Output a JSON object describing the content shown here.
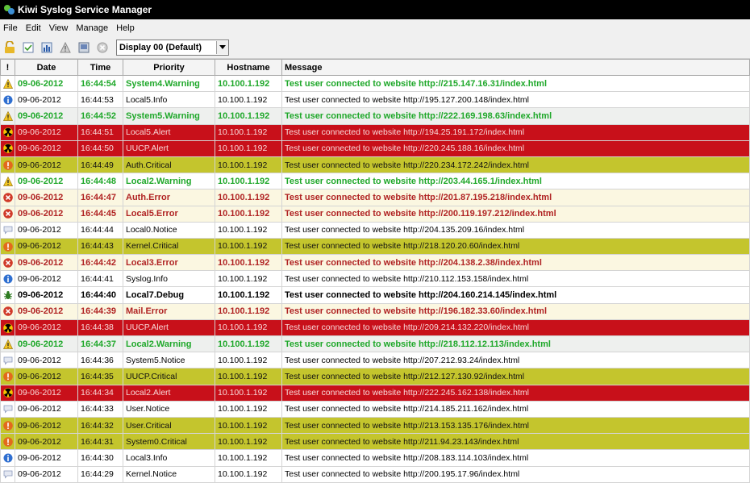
{
  "window": {
    "title": "Kiwi Syslog Service Manager"
  },
  "menu": [
    "File",
    "Edit",
    "View",
    "Manage",
    "Help"
  ],
  "toolbar": {
    "display_select": "Display 00 (Default)",
    "icons": [
      "unlock-icon",
      "checklist-icon",
      "stats-icon",
      "warning-icon",
      "clear-icon",
      "stop-icon"
    ]
  },
  "table": {
    "headers": [
      "!",
      "Date",
      "Time",
      "Priority",
      "Hostname",
      "Message"
    ],
    "rows": [
      {
        "icon": "warning",
        "style": "g bold",
        "date": "09-06-2012",
        "time": "16:44:54",
        "priority": "System4.Warning",
        "host": "10.100.1.192",
        "msg": "Test user connected to website http://215.147.16.31/index.html"
      },
      {
        "icon": "info",
        "style": "",
        "date": "09-06-2012",
        "time": "16:44:53",
        "priority": "Local5.Info",
        "host": "10.100.1.192",
        "msg": "Test user connected to website http://195.127.200.148/index.html"
      },
      {
        "icon": "warning",
        "style": "g bold alt",
        "date": "09-06-2012",
        "time": "16:44:52",
        "priority": "System5.Warning",
        "host": "10.100.1.192",
        "msg": "Test user connected to website http://222.169.198.63/index.html"
      },
      {
        "icon": "alert",
        "style": "sel",
        "date": "09-06-2012",
        "time": "16:44:51",
        "priority": "Local5.Alert",
        "host": "10.100.1.192",
        "msg": "Test user connected to website http://194.25.191.172/index.html"
      },
      {
        "icon": "alert",
        "style": "sel",
        "date": "09-06-2012",
        "time": "16:44:50",
        "priority": "UUCP.Alert",
        "host": "10.100.1.192",
        "msg": "Test user connected to website http://220.245.188.16/index.html"
      },
      {
        "icon": "critical",
        "style": "y",
        "date": "09-06-2012",
        "time": "16:44:49",
        "priority": "Auth.Critical",
        "host": "10.100.1.192",
        "msg": "Test user connected to website http://220.234.172.242/index.html"
      },
      {
        "icon": "warning",
        "style": "g bold",
        "date": "09-06-2012",
        "time": "16:44:48",
        "priority": "Local2.Warning",
        "host": "10.100.1.192",
        "msg": "Test user connected to website http://203.44.165.1/index.html"
      },
      {
        "icon": "error",
        "style": "r bold cream",
        "date": "09-06-2012",
        "time": "16:44:47",
        "priority": "Auth.Error",
        "host": "10.100.1.192",
        "msg": "Test user connected to website http://201.87.195.218/index.html"
      },
      {
        "icon": "error",
        "style": "r bold cream",
        "date": "09-06-2012",
        "time": "16:44:45",
        "priority": "Local5.Error",
        "host": "10.100.1.192",
        "msg": "Test user connected to website http://200.119.197.212/index.html"
      },
      {
        "icon": "notice",
        "style": "",
        "date": "09-06-2012",
        "time": "16:44:44",
        "priority": "Local0.Notice",
        "host": "10.100.1.192",
        "msg": "Test user connected to website http://204.135.209.16/index.html"
      },
      {
        "icon": "critical",
        "style": "y",
        "date": "09-06-2012",
        "time": "16:44:43",
        "priority": "Kernel.Critical",
        "host": "10.100.1.192",
        "msg": "Test user connected to website http://218.120.20.60/index.html"
      },
      {
        "icon": "error",
        "style": "r bold cream",
        "date": "09-06-2012",
        "time": "16:44:42",
        "priority": "Local3.Error",
        "host": "10.100.1.192",
        "msg": "Test user connected to website http://204.138.2.38/index.html"
      },
      {
        "icon": "info",
        "style": "",
        "date": "09-06-2012",
        "time": "16:44:41",
        "priority": "Syslog.Info",
        "host": "10.100.1.192",
        "msg": "Test user connected to website http://210.112.153.158/index.html"
      },
      {
        "icon": "debug",
        "style": "bold",
        "date": "09-06-2012",
        "time": "16:44:40",
        "priority": "Local7.Debug",
        "host": "10.100.1.192",
        "msg": "Test user connected to website http://204.160.214.145/index.html"
      },
      {
        "icon": "error",
        "style": "r bold cream",
        "date": "09-06-2012",
        "time": "16:44:39",
        "priority": "Mail.Error",
        "host": "10.100.1.192",
        "msg": "Test user connected to website http://196.182.33.60/index.html"
      },
      {
        "icon": "alert",
        "style": "sel",
        "date": "09-06-2012",
        "time": "16:44:38",
        "priority": "UUCP.Alert",
        "host": "10.100.1.192",
        "msg": "Test user connected to website http://209.214.132.220/index.html"
      },
      {
        "icon": "warning",
        "style": "g bold alt",
        "date": "09-06-2012",
        "time": "16:44:37",
        "priority": "Local2.Warning",
        "host": "10.100.1.192",
        "msg": "Test user connected to website http://218.112.12.113/index.html"
      },
      {
        "icon": "notice",
        "style": "",
        "date": "09-06-2012",
        "time": "16:44:36",
        "priority": "System5.Notice",
        "host": "10.100.1.192",
        "msg": "Test user connected to website http://207.212.93.24/index.html"
      },
      {
        "icon": "critical",
        "style": "y",
        "date": "09-06-2012",
        "time": "16:44:35",
        "priority": "UUCP.Critical",
        "host": "10.100.1.192",
        "msg": "Test user connected to website http://212.127.130.92/index.html"
      },
      {
        "icon": "alert",
        "style": "sel",
        "date": "09-06-2012",
        "time": "16:44:34",
        "priority": "Local2.Alert",
        "host": "10.100.1.192",
        "msg": "Test user connected to website http://222.245.162.138/index.html"
      },
      {
        "icon": "notice",
        "style": "",
        "date": "09-06-2012",
        "time": "16:44:33",
        "priority": "User.Notice",
        "host": "10.100.1.192",
        "msg": "Test user connected to website http://214.185.211.162/index.html"
      },
      {
        "icon": "critical",
        "style": "y",
        "date": "09-06-2012",
        "time": "16:44:32",
        "priority": "User.Critical",
        "host": "10.100.1.192",
        "msg": "Test user connected to website http://213.153.135.176/index.html"
      },
      {
        "icon": "critical",
        "style": "y",
        "date": "09-06-2012",
        "time": "16:44:31",
        "priority": "System0.Critical",
        "host": "10.100.1.192",
        "msg": "Test user connected to website http://211.94.23.143/index.html"
      },
      {
        "icon": "info",
        "style": "",
        "date": "09-06-2012",
        "time": "16:44:30",
        "priority": "Local3.Info",
        "host": "10.100.1.192",
        "msg": "Test user connected to website http://208.183.114.103/index.html"
      },
      {
        "icon": "notice",
        "style": "",
        "date": "09-06-2012",
        "time": "16:44:29",
        "priority": "Kernel.Notice",
        "host": "10.100.1.192",
        "msg": "Test user connected to website http://200.195.17.96/index.html"
      }
    ]
  }
}
